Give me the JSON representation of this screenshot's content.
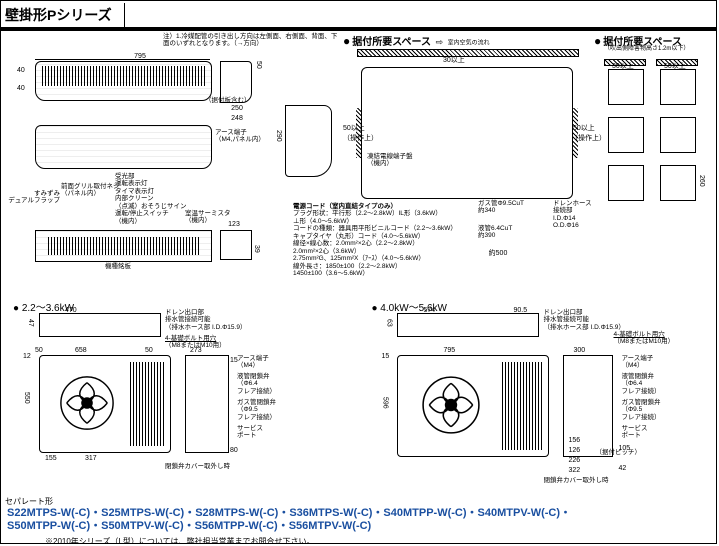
{
  "title": "壁掛形Pシリーズ",
  "top_note": "注）1.冷媒配管の引き出し方向は左側面、右側面、背面、下面のいずれとなります。（→方向）",
  "sections": {
    "install_space": "据付所要スペース",
    "room_airflow": "室内空気の流れ",
    "place_space": "据付所要スペース",
    "place_sub": "（吹出側障害物高さ1.2m以下）"
  },
  "dims": {
    "w795": "795",
    "h40_1": "40",
    "h40_2": "40",
    "w250": "250",
    "w248": "248",
    "w250_note": "（据付板含む）",
    "h50_1": "50",
    "h290": "290",
    "d123": "123",
    "h39": "39",
    "w50_l": "50以上",
    "w50_r": "50以上",
    "h30_top": "30以上",
    "op_l": "（操作上）",
    "op_r": "（操作上）",
    "gas_pipe": "ガス管Φ9.5CuT",
    "gas_len": "約340",
    "liq_pipe": "液管6.4CuT",
    "liq_len": "約390",
    "total_len": "約500",
    "drain": "ドレンホース",
    "drain_id": "接続部",
    "drain_id2": "I.D.Φ14",
    "drain_od": "O.D.Φ16",
    "cord_title": "電源コード（室内直結タイプのみ）",
    "plug_shape": "プラグ形状",
    "plug_shape_v": "：平行形（2.2～2.8kW）IL形（3.6kW）",
    "plug_shape_v2": "  ⊥形（4.0～5.6kW）",
    "cord_type": "コードの種類",
    "cord_type_v": "：器具用平形ビニルコード（2.2～3.6kW）",
    "cord_type_v2": "  キャプタイヤ（丸形）コード（4.0～5.6kW）",
    "wire": "線径×線心数",
    "wire_v": "：2.0mm²×2心（2.2～2.8kW）",
    "wire_v2": "  2.0mm²×2心（3.6kW）",
    "wire_v3": "  2.75mm²G、125mm²X（ｱｰｽ）（4.0～5.6kW）",
    "wire_l": "線外長さ",
    "wire_l_v": "：1850±100（2.2～2.8kW）",
    "wire_l_v2": "  1450±100（3.6～5.6kW）",
    "earth": "アース端子",
    "earth_sub": "（M4,パネル内）",
    "lamp_list1": "受光部",
    "lamp_list2": "運転表示灯",
    "lamp_list3": "タイマ表示灯",
    "lamp_list4": "内部クリーン",
    "lamp_list5": "（点滅）おそうじサイン",
    "lamp_list6": "運転/停止スイッチ",
    "lamp_list7": "（機内）",
    "thermistor": "室温サーミスタ",
    "thermistor_sub": "（機内）",
    "dual_flap": "すみずみ",
    "dual_flap2": "デュアルフラップ",
    "grille_screw": "前面グリル取付ネジ",
    "grille_screw2": "（パネル内）",
    "nameplate": "機種銘板",
    "freeze": "凍結電線端子盤",
    "freeze_sub": "（機内）",
    "right_h30": "30以上",
    "right_h50": "50以上",
    "right_h260": "260"
  },
  "outdoor_small": {
    "range": "● 2.2～3.6kW",
    "w470": "470",
    "h47": "47",
    "w658": "658",
    "d50_1": "50",
    "d50_2": "50",
    "h12": "12",
    "h550": "550",
    "w155": "155",
    "w317": "317",
    "d80": "80",
    "h15": "15",
    "d273": "273",
    "drain_caption": "ドレン出口部",
    "drain_caption2": "排水管接続可能",
    "drain_caption3": "（排水ホース部 I.D.Φ15.9）",
    "bolt": "4-基礎ボルト用穴",
    "bolt2": "（M8またはM10用）",
    "earth_m4": "アース端子",
    "earth_m4_2": "（M4）",
    "valve_gas": "ガス管閉鎖弁",
    "valve_gas2": "（Φ9.5",
    "valve_gas3": "フレア接続）",
    "valve_liq": "液管閉鎖弁",
    "valve_liq2": "（Φ6.4",
    "valve_liq3": "フレア接続）",
    "service": "サービス",
    "service2": "ポート",
    "cover": "閉鎖弁カバー取外し時"
  },
  "outdoor_large": {
    "range": "● 4.0kW～5.6kW",
    "w574": "574",
    "w90_5": "90.5",
    "h63": "63",
    "w795": "795",
    "h15": "15",
    "h596": "596",
    "d300": "300",
    "d105": "105",
    "d156": "156",
    "w126": "126",
    "w226": "226",
    "w322": "322",
    "pitch": "（据付ピッチ）",
    "h42": "42",
    "cover": "閉鎖弁カバー取外し時",
    "drain_caption": "ドレン出口部",
    "drain_caption2": "排水管接続可能",
    "drain_caption3": "（排水ホース部 I.D.Φ15.9）",
    "bolt": "4-基礎ボルト用穴",
    "bolt2": "（M8またはM10用）",
    "earth_m4": "アース端子",
    "earth_m4_2": "（M4）",
    "valve_gas": "ガス管閉鎖弁",
    "valve_gas2": "（Φ9.5",
    "valve_gas3": "フレア接続）",
    "valve_liq": "液管閉鎖弁",
    "valve_liq2": "（Φ6.4",
    "valve_liq3": "フレア接続）",
    "service": "サービス",
    "service2": "ポート"
  },
  "separator_label": "セパレート形",
  "models_line1": "S22MTPS-W(-C)・S25MTPS-W(-C)・S28MTPS-W(-C)・S36MTPS-W(-C)・S40MTPP-W(-C)・S40MTPV-W(-C)・",
  "models_line2": "S50MTPP-W(-C)・S50MTPV-W(-C)・S56MTPP-W(-C)・S56MTPV-W(-C)",
  "bottom_note": "※2010年シリーズ（L型）については、弊社担当営業までお問合せ下さい。"
}
